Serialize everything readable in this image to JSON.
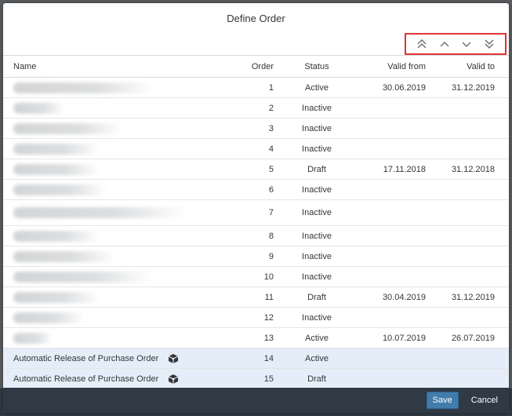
{
  "dialog": {
    "title": "Define Order"
  },
  "toolbar": {
    "icons": [
      "move-to-top-icon",
      "move-up-icon",
      "move-down-icon",
      "move-to-bottom-icon"
    ],
    "highlight_color": "#e03434"
  },
  "table": {
    "headers": {
      "name": "Name",
      "order": "Order",
      "status": "Status",
      "valid_from": "Valid from",
      "valid_to": "Valid to"
    },
    "rows": [
      {
        "name": "",
        "order": "1",
        "status": "Active",
        "valid_from": "30.06.2019",
        "valid_to": "31.12.2019"
      },
      {
        "name": "",
        "order": "2",
        "status": "Inactive",
        "valid_from": "",
        "valid_to": ""
      },
      {
        "name": "",
        "order": "3",
        "status": "Inactive",
        "valid_from": "",
        "valid_to": ""
      },
      {
        "name": "",
        "order": "4",
        "status": "Inactive",
        "valid_from": "",
        "valid_to": ""
      },
      {
        "name": "",
        "order": "5",
        "status": "Draft",
        "valid_from": "17.11.2018",
        "valid_to": "31.12.2018"
      },
      {
        "name": "",
        "order": "6",
        "status": "Inactive",
        "valid_from": "",
        "valid_to": ""
      },
      {
        "name": "",
        "order": "7",
        "status": "Inactive",
        "valid_from": "",
        "valid_to": ""
      },
      {
        "name": "",
        "order": "8",
        "status": "Inactive",
        "valid_from": "",
        "valid_to": ""
      },
      {
        "name": "",
        "order": "9",
        "status": "Inactive",
        "valid_from": "",
        "valid_to": ""
      },
      {
        "name": "",
        "order": "10",
        "status": "Inactive",
        "valid_from": "",
        "valid_to": ""
      },
      {
        "name": "",
        "order": "11",
        "status": "Draft",
        "valid_from": "30.04.2019",
        "valid_to": "31.12.2019"
      },
      {
        "name": "",
        "order": "12",
        "status": "Inactive",
        "valid_from": "",
        "valid_to": ""
      },
      {
        "name": "",
        "order": "13",
        "status": "Active",
        "valid_from": "10.07.2019",
        "valid_to": "26.07.2019"
      },
      {
        "name": "Automatic Release of Purchase Order",
        "order": "14",
        "status": "Active",
        "valid_from": "",
        "valid_to": ""
      },
      {
        "name": "Automatic Release of Purchase Order",
        "order": "15",
        "status": "Draft",
        "valid_from": "",
        "valid_to": ""
      }
    ]
  },
  "footer": {
    "save_label": "Save",
    "cancel_label": "Cancel"
  },
  "colors": {
    "footer_bg": "#2f3a45",
    "save_bg": "#427cac",
    "selected_row": "#e5eef8"
  }
}
